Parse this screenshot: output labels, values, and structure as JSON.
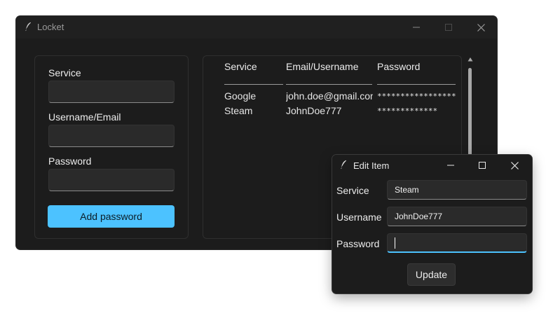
{
  "main_window": {
    "title": "Locket",
    "form": {
      "service_label": "Service",
      "username_label": "Username/Email",
      "password_label": "Password",
      "add_button": "Add password"
    },
    "table": {
      "columns": [
        "Service",
        "Email/Username",
        "Password"
      ],
      "rows": [
        {
          "service": "Google",
          "username": "john.doe@gmail.com",
          "password": "********************"
        },
        {
          "service": "Steam",
          "username": "JohnDoe777",
          "password": "*************"
        }
      ]
    }
  },
  "edit_window": {
    "title": "Edit Item",
    "service_label": "Service",
    "service_value": "Steam",
    "username_label": "Username",
    "username_value": "JohnDoe777",
    "password_label": "Password",
    "password_value": "",
    "update_button": "Update"
  },
  "colors": {
    "accent": "#4cc2ff",
    "window_bg": "#1c1c1c",
    "field_bg": "#2a2a2a"
  },
  "icons": [
    "feather-icon",
    "minimize-icon",
    "maximize-icon",
    "close-icon",
    "scroll-up-icon"
  ]
}
